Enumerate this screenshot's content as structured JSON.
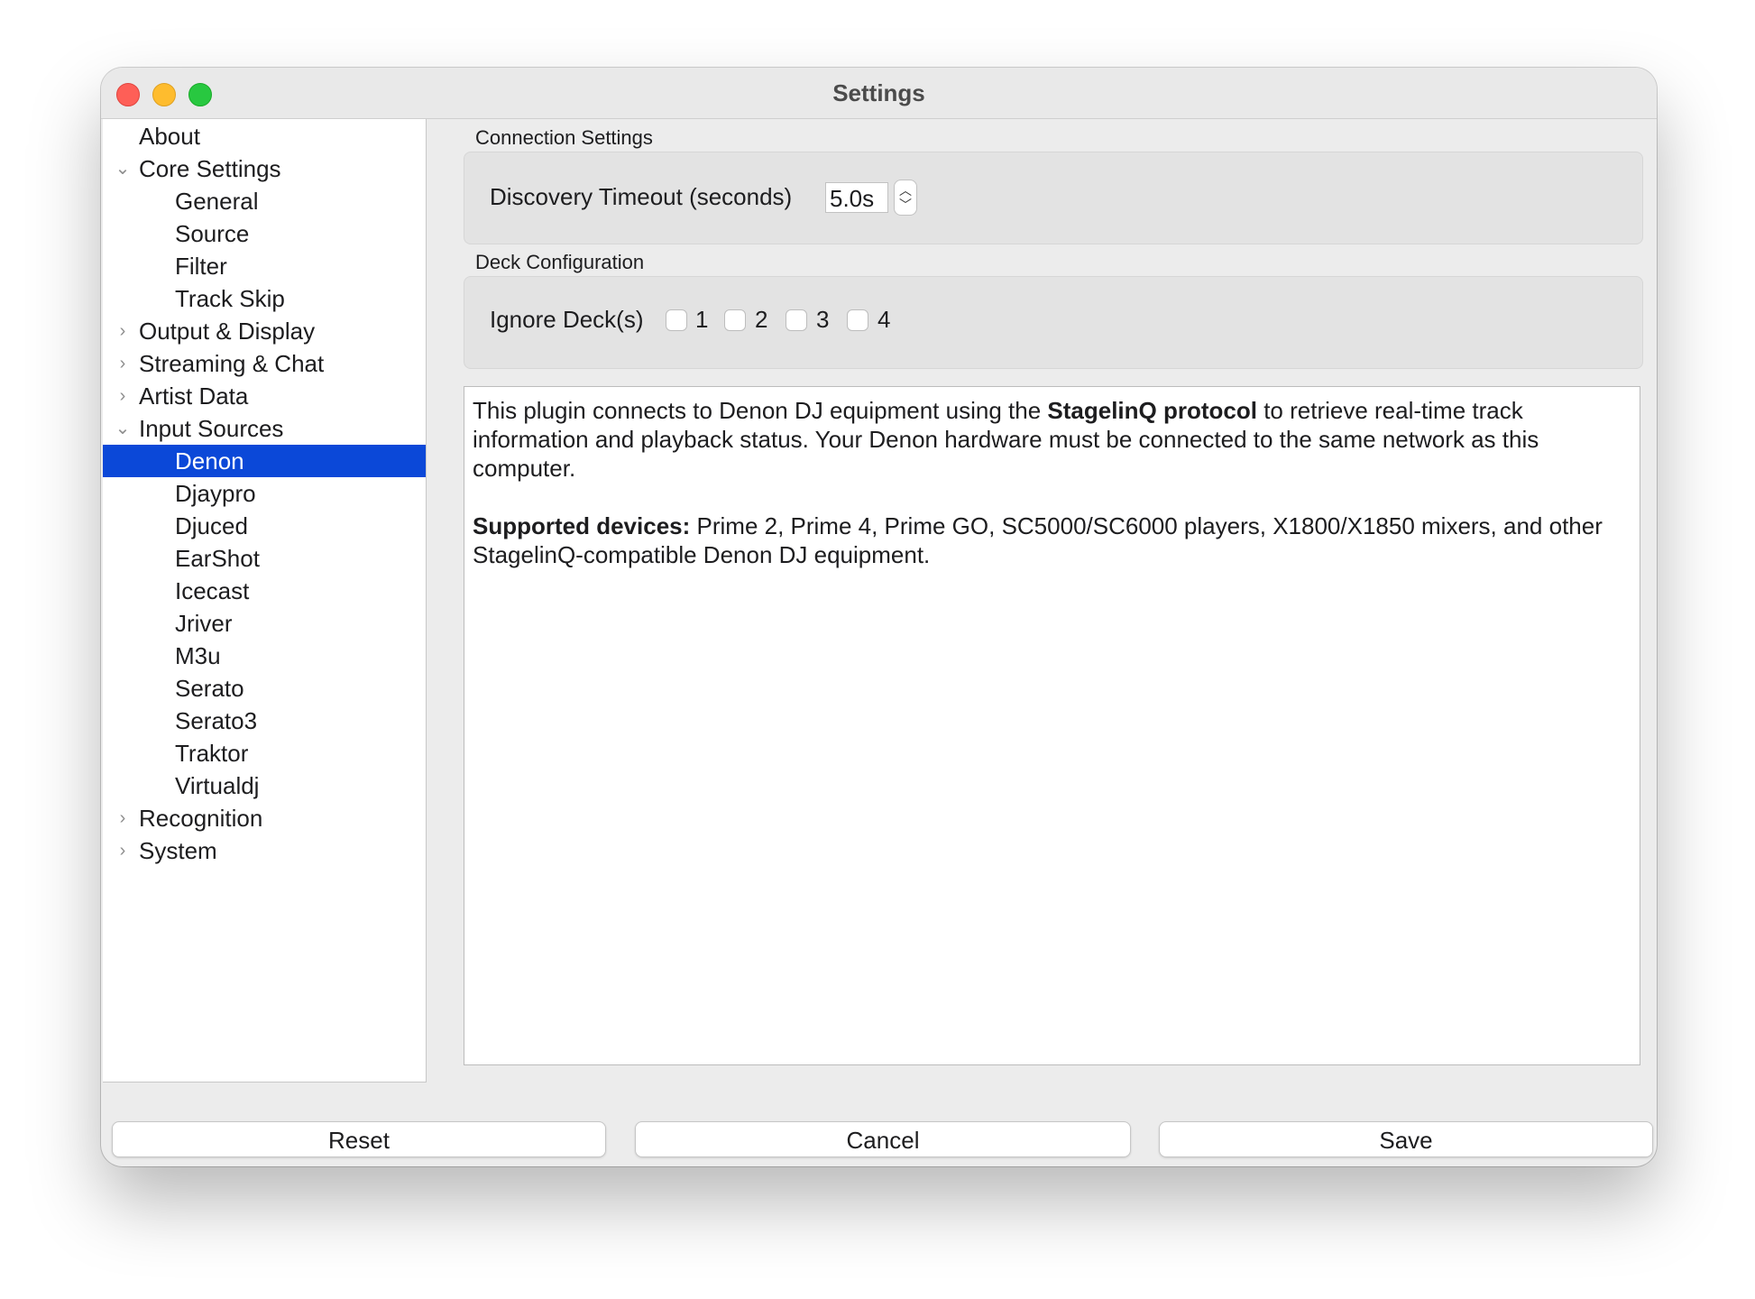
{
  "window": {
    "title": "Settings"
  },
  "sidebar": {
    "items": [
      {
        "label": "About",
        "arrow": ""
      },
      {
        "label": "Core Settings",
        "arrow": "⌄"
      },
      {
        "label": "General",
        "arrow": ""
      },
      {
        "label": "Source",
        "arrow": ""
      },
      {
        "label": "Filter",
        "arrow": ""
      },
      {
        "label": "Track Skip",
        "arrow": ""
      },
      {
        "label": "Output & Display",
        "arrow": "›"
      },
      {
        "label": "Streaming & Chat",
        "arrow": "›"
      },
      {
        "label": "Artist Data",
        "arrow": "›"
      },
      {
        "label": "Input Sources",
        "arrow": "⌄"
      },
      {
        "label": "Denon",
        "arrow": ""
      },
      {
        "label": "Djaypro",
        "arrow": ""
      },
      {
        "label": "Djuced",
        "arrow": ""
      },
      {
        "label": "EarShot",
        "arrow": ""
      },
      {
        "label": "Icecast",
        "arrow": ""
      },
      {
        "label": "Jriver",
        "arrow": ""
      },
      {
        "label": "M3u",
        "arrow": ""
      },
      {
        "label": "Serato",
        "arrow": ""
      },
      {
        "label": "Serato3",
        "arrow": ""
      },
      {
        "label": "Traktor",
        "arrow": ""
      },
      {
        "label": "Virtualdj",
        "arrow": ""
      },
      {
        "label": "Recognition",
        "arrow": "›"
      },
      {
        "label": "System",
        "arrow": "›"
      }
    ],
    "selected": "Denon"
  },
  "connection": {
    "section_title": "Connection Settings",
    "timeout_label": "Discovery Timeout (seconds)",
    "timeout_value": "5.0s"
  },
  "deck": {
    "section_title": "Deck Configuration",
    "ignore_label": "Ignore Deck(s)",
    "decks": [
      "1",
      "2",
      "3",
      "4"
    ]
  },
  "description": {
    "p1_pre": "This plugin connects to Denon DJ equipment using the ",
    "p1_bold": "StagelinQ protocol",
    "p1_post": " to retrieve real-time track information and playback status. Your Denon hardware must be connected to the same network as this computer.",
    "p2_bold": "Supported devices:",
    "p2_post": " Prime 2, Prime 4, Prime GO, SC5000/SC6000 players, X1800/X1850 mixers, and other StagelinQ-compatible Denon DJ equipment."
  },
  "buttons": {
    "reset": "Reset",
    "cancel": "Cancel",
    "save": "Save"
  },
  "colors": {
    "selection": "#0b48d8"
  }
}
